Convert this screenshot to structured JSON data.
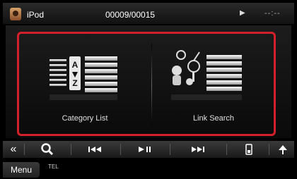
{
  "status_bar": {
    "source": "iPod",
    "track_counter": "00009/00015",
    "time": "--:--"
  },
  "main": {
    "tiles": [
      {
        "label": "Category List",
        "icon": "category-list-icon"
      },
      {
        "label": "Link Search",
        "icon": "link-search-icon"
      }
    ],
    "highlight_color": "#d4202a"
  },
  "control_bar": {
    "buttons": [
      "collapse",
      "search",
      "previous",
      "play-pause",
      "next",
      "mode",
      "eject"
    ]
  },
  "bottom": {
    "menu_label": "Menu",
    "tel_label": "TEL"
  }
}
